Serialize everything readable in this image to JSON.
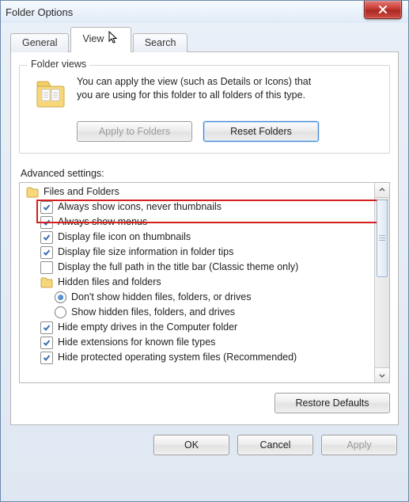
{
  "window": {
    "title": "Folder Options"
  },
  "tabs": {
    "general": "General",
    "view": "View",
    "search": "Search",
    "active": "view"
  },
  "folder_views": {
    "legend": "Folder views",
    "text_line1": "You can apply the view (such as Details or Icons) that",
    "text_line2": "you are using for this folder to all folders of this type.",
    "apply_btn": "Apply to Folders",
    "reset_btn": "Reset Folders"
  },
  "advanced": {
    "label": "Advanced settings:",
    "root": "Files and Folders",
    "items": [
      {
        "type": "check",
        "checked": true,
        "label": "Always show icons, never thumbnails",
        "highlight": true
      },
      {
        "type": "check",
        "checked": true,
        "label": "Always show menus"
      },
      {
        "type": "check",
        "checked": true,
        "label": "Display file icon on thumbnails"
      },
      {
        "type": "check",
        "checked": true,
        "label": "Display file size information in folder tips"
      },
      {
        "type": "check",
        "checked": false,
        "label": "Display the full path in the title bar (Classic theme only)"
      },
      {
        "type": "folder",
        "label": "Hidden files and folders"
      },
      {
        "type": "radio",
        "checked": true,
        "label": "Don't show hidden files, folders, or drives"
      },
      {
        "type": "radio",
        "checked": false,
        "label": "Show hidden files, folders, and drives"
      },
      {
        "type": "check",
        "checked": true,
        "label": "Hide empty drives in the Computer folder"
      },
      {
        "type": "check",
        "checked": true,
        "label": "Hide extensions for known file types"
      },
      {
        "type": "check",
        "checked": true,
        "label": "Hide protected operating system files (Recommended)"
      }
    ],
    "restore_btn": "Restore Defaults"
  },
  "dialog": {
    "ok": "OK",
    "cancel": "Cancel",
    "apply": "Apply"
  },
  "colors": {
    "highlight": "#d42020",
    "accent": "#4a8bd6"
  }
}
